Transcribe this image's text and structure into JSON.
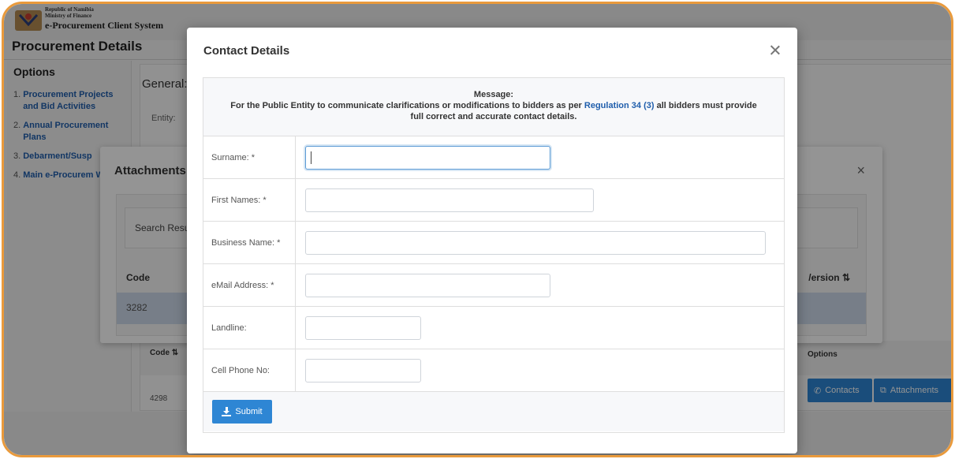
{
  "header": {
    "logo_line1": "Republic of Namibia",
    "logo_line2": "Ministry of Finance",
    "system_title": "e-Procurement Client System",
    "page_heading": "Procurement Details"
  },
  "sidebar": {
    "title": "Options",
    "items": [
      {
        "num": "1.",
        "label": "Procurement Projects and Bid Activities"
      },
      {
        "num": "2.",
        "label": "Annual Procurement Plans"
      },
      {
        "num": "3.",
        "label": "Debarment/Susp"
      },
      {
        "num": "4.",
        "label": "Main e-Procurem Website"
      }
    ]
  },
  "background_main": {
    "general_label": "General:",
    "entity_label": "Entity:",
    "table_code_header": "Code ⇅",
    "table_options_header": "Options",
    "row_code": "4298",
    "contacts_button": "Contacts",
    "attachments_button": "Attachments"
  },
  "attachments_modal": {
    "title": "Attachments",
    "search_label": "Search Resul",
    "code_header": "Code",
    "version_header": "/ersion ⇅",
    "row_code": "3282"
  },
  "contact_modal": {
    "title": "Contact Details",
    "message_heading": "Message:",
    "message_before_link": "For the Public Entity to communicate clarifications or modifications to bidders as per ",
    "message_link": "Regulation 34 (3)",
    "message_after_link": " all bidders must provide",
    "message_line2": "full correct and accurate contact details.",
    "fields": {
      "surname": {
        "label": "Surname: *",
        "value": ""
      },
      "first_names": {
        "label": "First Names: *",
        "value": ""
      },
      "business_name": {
        "label": "Business Name: *",
        "value": ""
      },
      "email": {
        "label": "eMail Address: *",
        "value": ""
      },
      "landline": {
        "label": "Landline:",
        "value": ""
      },
      "cell_phone": {
        "label": "Cell Phone No:",
        "value": ""
      }
    },
    "submit_label": "Submit"
  },
  "colors": {
    "accent": "#2e86d4",
    "link": "#1f5eac",
    "frame": "#e99a3c"
  }
}
